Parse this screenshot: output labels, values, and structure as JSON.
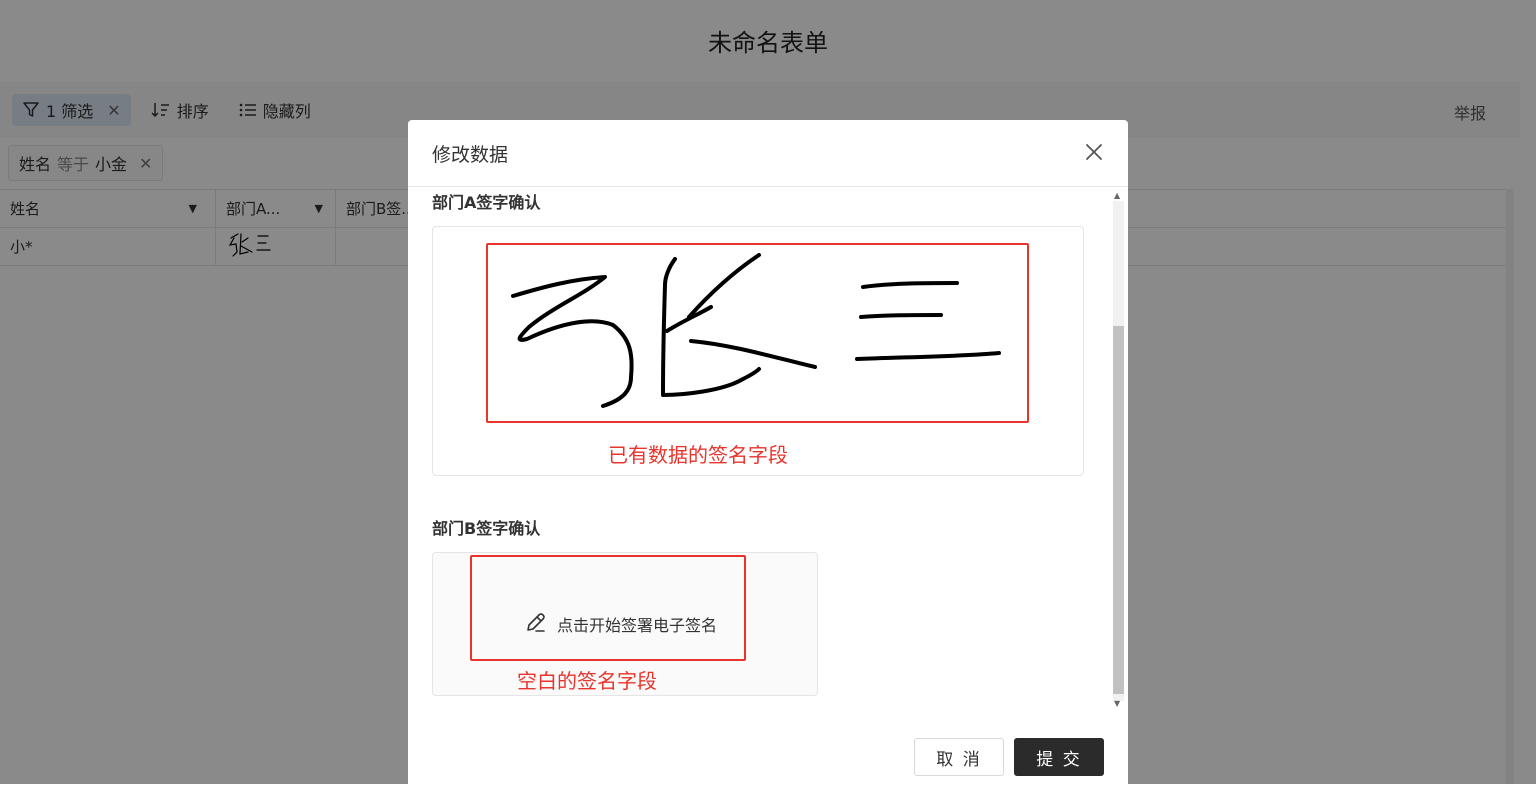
{
  "page": {
    "title": "未命名表单"
  },
  "toolbar": {
    "filter_label": "1 筛选",
    "sort_label": "排序",
    "hide_label": "隐藏列",
    "report_label": "举报"
  },
  "filter_chip": {
    "field": "姓名",
    "operator": "等于",
    "value": "小金"
  },
  "table": {
    "columns": [
      "姓名",
      "部门A...",
      "部门B签..."
    ],
    "rows": [
      {
        "name": "小*"
      }
    ]
  },
  "modal": {
    "title": "修改数据",
    "field_a_label": "部门A签字确认",
    "field_a_note": "已有数据的签名字段",
    "field_b_label": "部门B签字确认",
    "field_b_hint": "点击开始签署电子签名",
    "field_b_note": "空白的签名字段",
    "cancel_label": "取 消",
    "submit_label": "提 交"
  },
  "colors": {
    "annotation": "#e8342c",
    "primary_button": "#2b2b2b",
    "active_filter": "#dde7f6"
  },
  "icons": [
    "filter-icon",
    "close-icon",
    "sort-icon",
    "list-icon",
    "pen-icon",
    "caret-down-icon"
  ]
}
